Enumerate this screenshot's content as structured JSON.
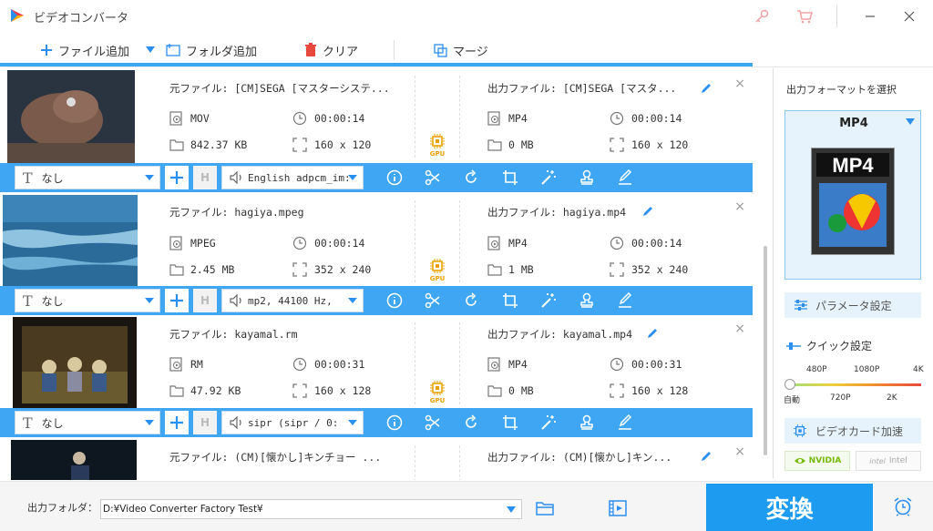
{
  "app": {
    "title": "ビデオコンバータ"
  },
  "toolbar": {
    "add_file": "ファイル追加",
    "add_folder": "フォルダ追加",
    "clear": "クリア",
    "merge": "マージ"
  },
  "items": [
    {
      "src_label": "元ファイル: [CM]SEGA [マスターシステ...",
      "src_format": "MOV",
      "src_duration": "00:00:14",
      "src_size": "842.37 KB",
      "src_res": "160 x 120",
      "out_label": "出力ファイル: [CM]SEGA [マスタ...",
      "out_format": "MP4",
      "out_duration": "00:00:14",
      "out_size": "0 MB",
      "out_res": "160 x 120",
      "subtitle": "なし",
      "audio": "English adpcm_im:"
    },
    {
      "src_label": "元ファイル: hagiya.mpeg",
      "src_format": "MPEG",
      "src_duration": "00:00:14",
      "src_size": "2.45 MB",
      "src_res": "352 x 240",
      "out_label": "出力ファイル: hagiya.mp4",
      "out_format": "MP4",
      "out_duration": "00:00:14",
      "out_size": "1 MB",
      "out_res": "352 x 240",
      "subtitle": "なし",
      "audio": "mp2, 44100 Hz,"
    },
    {
      "src_label": "元ファイル: kayamal.rm",
      "src_format": "RM",
      "src_duration": "00:00:31",
      "src_size": "47.92 KB",
      "src_res": "160 x 128",
      "out_label": "出力ファイル: kayamal.mp4",
      "out_format": "MP4",
      "out_duration": "00:00:31",
      "out_size": "0 MB",
      "out_res": "160 x 128",
      "subtitle": "なし",
      "audio": "sipr (sipr / 0:"
    },
    {
      "src_label": "元ファイル: (CM)[懐かし]キンチョー ...",
      "out_label": "出力ファイル: (CM)[懐かし]キン..."
    }
  ],
  "gpu_label": "GPU",
  "right": {
    "select_format": "出力フォーマットを選択",
    "format": "MP4",
    "params": "パラメータ設定",
    "quick": "クイック設定",
    "q_top": [
      "480P",
      "1080P",
      "4K"
    ],
    "q_bottom": [
      "自動",
      "720P",
      "2K"
    ],
    "gpu_accel": "ビデオカード加速",
    "nvidia": "NVIDIA",
    "intel": "Intel"
  },
  "bottom": {
    "out_folder_label": "出力フォルダ：",
    "out_folder": "D:¥Video Converter Factory Test¥",
    "convert": "変換"
  }
}
